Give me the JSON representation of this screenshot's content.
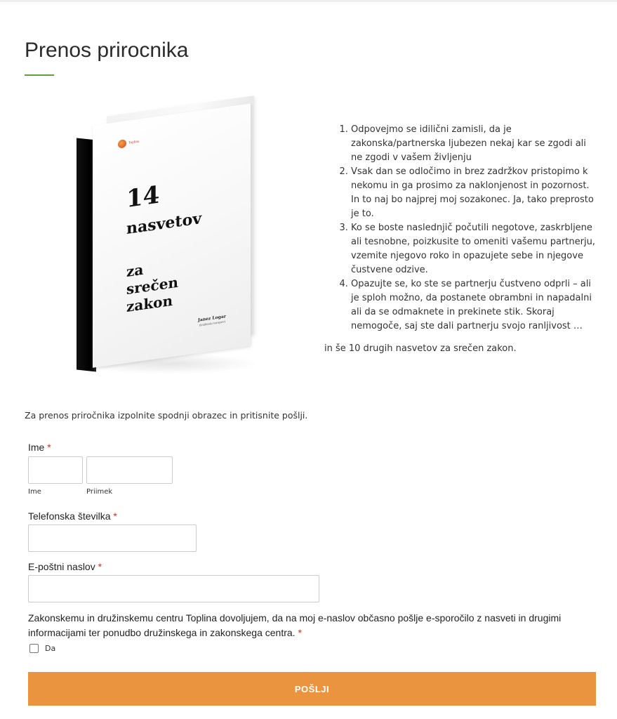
{
  "page": {
    "title": "Prenos prirocnika",
    "accent_color": "#5aa33a"
  },
  "book": {
    "logo_text": "Toplina",
    "cover_lines": [
      "14",
      "nasvetov",
      "za",
      "srečen",
      "zakon"
    ],
    "author": "Janez Logar",
    "author_subtitle": "družinski terapevt"
  },
  "tips": {
    "items": [
      "Odpovejmo se idilični zamisli, da je zakonska/partnerska ljubezen nekaj kar se zgodi ali ne zgodi v vašem življenju",
      "Vsak dan se odločimo in brez zadržkov pristopimo k nekomu in ga prosimo za naklonjenost in pozornost. In to naj bo najprej moj sozakonec. Ja, tako preprosto je to.",
      "Ko se boste naslednjič počutili negotove, zaskrbljene ali tesnobne, poizkusite to omeniti vašemu partnerju, vzemite njegovo roko in opazujete sebe in njegove čustvene odzive.",
      "Opazujte se, ko ste se partnerju čustveno odprli – ali je sploh možno, da postanete obrambni in napadalni ali da se odmaknete in prekinete stik. Skoraj nemogoče, saj ste dali partnerju svojo ranljivost …"
    ],
    "more": "in še 10 drugih nasvetov za srečen zakon."
  },
  "form": {
    "intro": "Za prenos priročnika izpolnite spodnji obrazec in pritisnite pošlji.",
    "required_mark": "*",
    "name": {
      "label": "Ime",
      "first_sublabel": "Ime",
      "last_sublabel": "Priimek",
      "first_value": "",
      "last_value": ""
    },
    "phone": {
      "label": "Telefonska številka",
      "value": ""
    },
    "email": {
      "label": "E-poštni naslov",
      "value": ""
    },
    "consent": {
      "text": "Zakonskemu in družinskemu centru Toplina dovoljujem, da na moj e-naslov občasno pošlje e-sporočilo z nasveti in drugimi informacijami ter ponudbo družinskega in zakonskega centra.",
      "checkbox_label": "Da",
      "checked": false
    },
    "submit_label": "POŠLJI",
    "submit_color": "#eb943f"
  }
}
